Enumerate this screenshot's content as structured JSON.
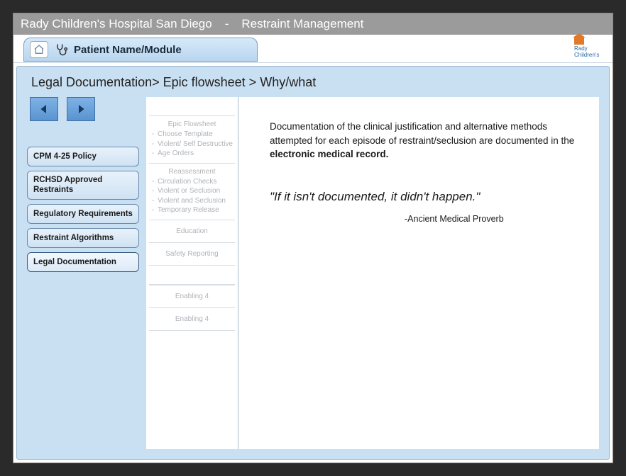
{
  "titlebar": {
    "org": "Rady Children's Hospital San Diego",
    "separator": "-",
    "app": "Restraint Management"
  },
  "tab": {
    "label": "Patient Name/Module"
  },
  "logo": {
    "line1": "Rady",
    "line2": "Children's"
  },
  "breadcrumb": "Legal Documentation> Epic flowsheet > Why/what",
  "sidebar": {
    "items": [
      {
        "label": "CPM 4-25 Policy"
      },
      {
        "label": "RCHSD Approved Restraints"
      },
      {
        "label": "Regulatory Requirements"
      },
      {
        "label": "Restraint Algorithms"
      },
      {
        "label": "Legal Documentation",
        "active": true
      }
    ]
  },
  "outline": {
    "block1": {
      "head": "Epic Flowsheet",
      "subs": [
        "Choose Template",
        "Violent/ Self Destructive",
        "Age Orders"
      ]
    },
    "block2": {
      "head": "Reassessment",
      "subs": [
        "Circulation Checks",
        "Violent or Seclusion",
        "Violent and Seclusion",
        "Temporary Release"
      ]
    },
    "singles": [
      "Education",
      "Safety Reporting"
    ],
    "footer": [
      "Enabling 4",
      "Enabling 4"
    ]
  },
  "main": {
    "desc_pre": "Documentation of the clinical justification and alternative methods attempted for each episode of restraint/seclusion are documented in the ",
    "desc_bold": "electronic medical record.",
    "quote": "\"If it isn't documented, it didn't happen.\"",
    "attribution": "-Ancient Medical Proverb"
  }
}
